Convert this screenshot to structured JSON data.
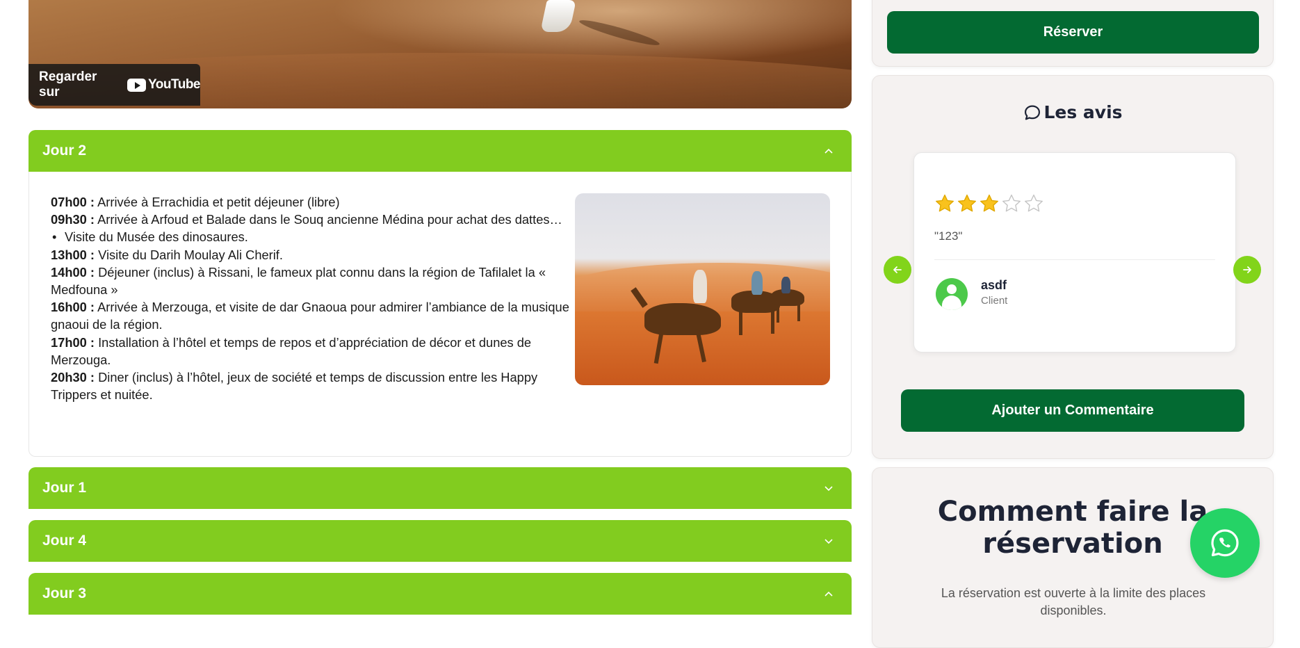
{
  "video": {
    "watch_on": "Regarder sur",
    "platform": "YouTube",
    "icon": "youtube-icon"
  },
  "accordion": [
    {
      "title": "Jour 2",
      "expanded": true
    },
    {
      "title": "Jour 1",
      "expanded": false
    },
    {
      "title": "Jour 4",
      "expanded": false
    },
    {
      "title": "Jour 3",
      "expanded": true
    }
  ],
  "day2": {
    "schedule": [
      {
        "time": "07h00 :",
        "text": " Arrivée à Errachidia et petit déjeuner (libre)"
      },
      {
        "time": "09h30 :",
        "text": " Arrivée à Arfoud et Balade dans le Souq ancienne Médina pour achat des dattes…"
      },
      {
        "bullet": "Visite du Musée des dinosaures."
      },
      {
        "time": "13h00 :",
        "text": " Visite du Darih Moulay Ali Cherif."
      },
      {
        "time": "14h00 :",
        "text": " Déjeuner (inclus) à Rissani, le fameux plat connu dans la région de Tafilalet la « Medfouna »"
      },
      {
        "time": "16h00 :",
        "text": " Arrivée à Merzouga, et visite de dar Gnaoua pour admirer l’ambiance de la musique gnaoui de la région."
      },
      {
        "time": "17h00 :",
        "text": " Installation à l’hôtel et temps de repos et d’appréciation de décor et dunes de Merzouga."
      },
      {
        "time": "20h30 :",
        "text": " Diner (inclus) à l’hôtel, jeux de société et temps de discussion entre les Happy Trippers et nuitée."
      }
    ]
  },
  "sidebar": {
    "reserve_label": "Réserver",
    "reviews": {
      "title": "Les avis",
      "icon": "chat-bubble-icon",
      "items": [
        {
          "rating": 3,
          "max_rating": 5,
          "quote": "\"123\"",
          "name": "asdf",
          "role": "Client"
        }
      ],
      "add_comment_label": "Ajouter un Commentaire"
    },
    "how": {
      "title": "Comment faire la réservation",
      "text": "La réservation est ouverte à la limite des places disponibles."
    }
  },
  "colors": {
    "accordion_green": "#82cc1f",
    "dark_green": "#036a32",
    "star_gold": "#f9c21d",
    "whatsapp_green": "#25d366"
  }
}
